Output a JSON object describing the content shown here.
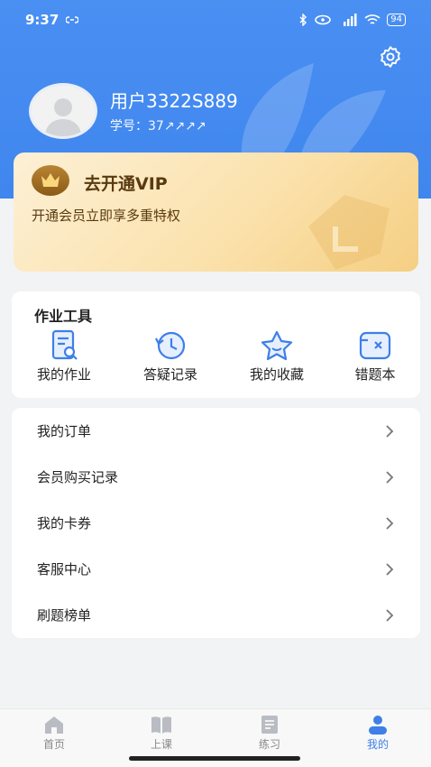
{
  "status_bar": {
    "time": "9:37",
    "battery": "94"
  },
  "profile": {
    "username": "用户3322S889",
    "student_id": "学号：37↗↗↗↗"
  },
  "vip": {
    "title": "去开通VIP",
    "subtitle": "开通会员立即享多重特权"
  },
  "tools": {
    "title": "作业工具",
    "items": [
      {
        "label": "我的作业",
        "icon": "homework-icon"
      },
      {
        "label": "答疑记录",
        "icon": "history-icon"
      },
      {
        "label": "我的收藏",
        "icon": "star-icon"
      },
      {
        "label": "错题本",
        "icon": "wrong-book-icon"
      }
    ]
  },
  "menu": [
    {
      "label": "我的订单"
    },
    {
      "label": "会员购买记录"
    },
    {
      "label": "我的卡券"
    },
    {
      "label": "客服中心"
    },
    {
      "label": "刷题榜单"
    }
  ],
  "tabbar": [
    {
      "label": "首页",
      "icon": "home-icon"
    },
    {
      "label": "上课",
      "icon": "book-icon"
    },
    {
      "label": "练习",
      "icon": "practice-icon"
    },
    {
      "label": "我的",
      "icon": "profile-icon",
      "active": true
    }
  ],
  "colors": {
    "header_blue": "#4a8ff2",
    "accent": "#3e7fe8",
    "vip_text": "#5a3a10"
  }
}
